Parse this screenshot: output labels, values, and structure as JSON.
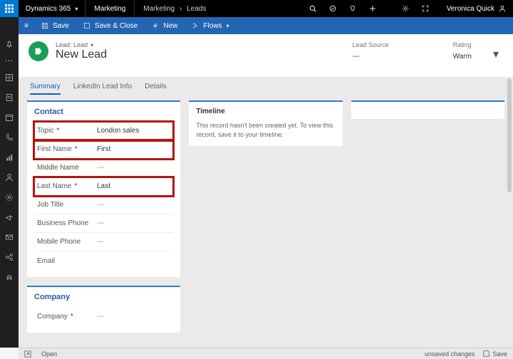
{
  "top": {
    "brand": "Dynamics 365",
    "app": "Marketing",
    "breadcrumb_area": "Marketing",
    "breadcrumb_sep": "›",
    "breadcrumb_page": "Leads",
    "user": "Veronica Quick"
  },
  "cmd": {
    "save": "Save",
    "save_close": "Save & Close",
    "new": "New",
    "flows": "Flows"
  },
  "header": {
    "entity_type": "Lead: Lead",
    "entity_name": "New Lead",
    "fields": {
      "lead_source": {
        "label": "Lead Source",
        "value": "---"
      },
      "rating": {
        "label": "Rating",
        "value": "Warm"
      }
    }
  },
  "tabs": {
    "summary": "Summary",
    "linkedin": "LinkedIn Lead Info",
    "details": "Details",
    "active": "summary"
  },
  "contact": {
    "title": "Contact",
    "fields": [
      {
        "label": "Topic",
        "required": true,
        "value": "London sales",
        "highlighted": true
      },
      {
        "label": "First Name",
        "required": true,
        "value": "First",
        "highlighted": true
      },
      {
        "label": "Middle Name",
        "required": false,
        "value": "---",
        "highlighted": false
      },
      {
        "label": "Last Name",
        "required": true,
        "value": "Last",
        "highlighted": true
      },
      {
        "label": "Job Title",
        "required": false,
        "value": "---",
        "highlighted": false
      },
      {
        "label": "Business Phone",
        "required": false,
        "value": "---",
        "highlighted": false
      },
      {
        "label": "Mobile Phone",
        "required": false,
        "value": "---",
        "highlighted": false
      },
      {
        "label": "Email",
        "required": false,
        "value": "",
        "highlighted": false
      }
    ]
  },
  "company": {
    "title": "Company",
    "fields": [
      {
        "label": "Company",
        "required": true,
        "value": "---"
      }
    ]
  },
  "timeline": {
    "title": "Timeline",
    "note": "This record hasn't been created yet. To view this record, save it to your timeline."
  },
  "status": {
    "open": "Open",
    "unsaved": "unsaved changes",
    "save": "Save"
  },
  "req_marker": "*"
}
